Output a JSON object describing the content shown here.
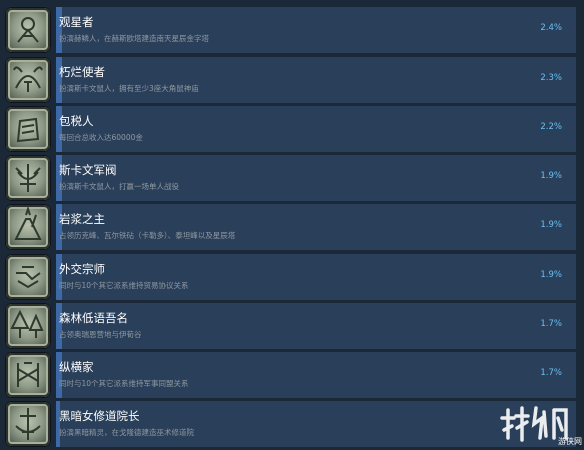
{
  "achievements": [
    {
      "name": "观星者",
      "desc": "扮演赫鳞人，在赫斯欧塔建造南天星辰金字塔",
      "percent": "2.4%",
      "fill": 0.024,
      "icon": "telescope-icon"
    },
    {
      "name": "朽烂使者",
      "desc": "扮演斯卡文鼠人，拥有至少3座大角鼠神庙",
      "percent": "2.3%",
      "fill": 0.023,
      "icon": "rat-horned-icon"
    },
    {
      "name": "包税人",
      "desc": "每回合总收入达60000金",
      "percent": "2.2%",
      "fill": 0.022,
      "icon": "coin-purse-icon"
    },
    {
      "name": "斯卡文军阀",
      "desc": "扮演斯卡文鼠人，打赢一场单人战役",
      "percent": "1.9%",
      "fill": 0.019,
      "icon": "rat-warlord-icon"
    },
    {
      "name": "岩浆之主",
      "desc": "占领历克峰、瓦尔铁砧（卡勒多）、泰坦峰以及星辰塔",
      "percent": "1.9%",
      "fill": 0.019,
      "icon": "volcano-icon"
    },
    {
      "name": "外交宗师",
      "desc": "同时与10个其它派系维持贸易协议关系",
      "percent": "1.9%",
      "fill": 0.019,
      "icon": "handshake-icon"
    },
    {
      "name": "森林低语吾名",
      "desc": "占领奥瑞恩营地与伊荀谷",
      "percent": "1.7%",
      "fill": 0.017,
      "icon": "forest-icon"
    },
    {
      "name": "纵横家",
      "desc": "同时与10个其它派系维持军事同盟关系",
      "percent": "1.7%",
      "fill": 0.017,
      "icon": "alliance-icon"
    },
    {
      "name": "黑暗女修道院长",
      "desc": "扮演黑暗精灵，在戈隆德建造巫术修道院",
      "percent": "",
      "fill": 0.0,
      "icon": "dark-convent-icon"
    }
  ],
  "watermark": {
    "text": "游侠网",
    "icon": "watermark-logo-icon"
  }
}
